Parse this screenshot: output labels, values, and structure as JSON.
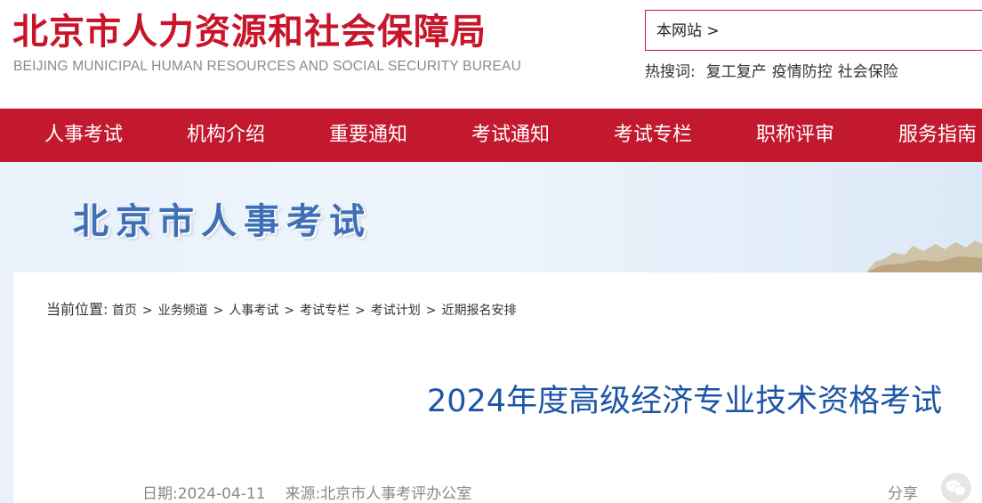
{
  "header": {
    "logo_cn": "北京市人力资源和社会保障局",
    "logo_en": "BEIJING MUNICIPAL HUMAN RESOURCES AND SOCIAL SECURITY BUREAU",
    "search_scope": "本网站 >",
    "hot_label": "热搜词:",
    "hot_words": [
      "复工复产",
      "疫情防控",
      "社会保险"
    ]
  },
  "nav": {
    "items": [
      "人事考试",
      "机构介绍",
      "重要通知",
      "考试通知",
      "考试专栏",
      "职称评审",
      "服务指南"
    ]
  },
  "banner": {
    "title": "北京市人事考试"
  },
  "breadcrumb": {
    "label": "当前位置:",
    "items": [
      "首页",
      "业务频道",
      "人事考试",
      "考试专栏",
      "考试计划",
      "近期报名安排"
    ],
    "separator": ">"
  },
  "article": {
    "title": "2024年度高级经济专业技术资格考试",
    "date_label": "日期:",
    "date": "2024-04-11",
    "source_label": "来源:",
    "source": "北京市人事考评办公室",
    "share_label": "分享"
  },
  "colors": {
    "brand_red": "#c3192e",
    "title_blue": "#1d56a6",
    "banner_blue": "#3f6fb6"
  },
  "icons": {
    "share": "wechat-icon"
  }
}
